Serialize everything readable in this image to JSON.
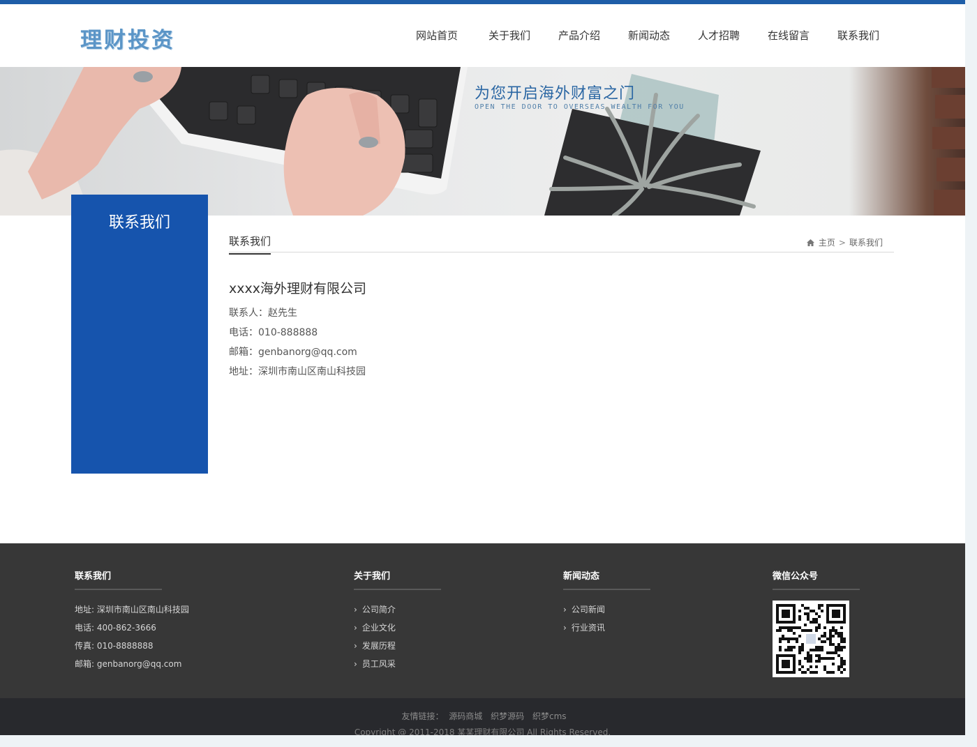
{
  "header": {
    "logo_text": "理财投资",
    "nav": [
      "网站首页",
      "关于我们",
      "产品介绍",
      "新闻动态",
      "人才招聘",
      "在线留言",
      "联系我们"
    ]
  },
  "banner": {
    "title": "为您开启海外财富之门",
    "subtitle": "OPEN THE DOOR TO OVERSEAS WEALTH FOR YOU"
  },
  "sidebar": {
    "title": "联系我们"
  },
  "content": {
    "title": "联系我们",
    "breadcrumb": {
      "home": "主页",
      "separator": ">",
      "current": "联系我们"
    },
    "company": "xxxx海外理财有限公司",
    "contact_person": "联系人：赵先生",
    "phone": "电话：010-888888",
    "email": "邮箱：genbanorg@qq.com",
    "address": "地址：深圳市南山区南山科技园"
  },
  "footer": {
    "contact": {
      "title": "联系我们",
      "items": [
        "地址: 深圳市南山区南山科技园",
        "电话: 400-862-3666",
        "传真: 010-8888888",
        "邮箱: genbanorg@qq.com"
      ]
    },
    "about": {
      "title": "关于我们",
      "items": [
        "公司简介",
        "企业文化",
        "发展历程",
        "员工风采"
      ]
    },
    "news": {
      "title": "新闻动态",
      "items": [
        "公司新闻",
        "行业资讯"
      ]
    },
    "wechat": {
      "title": "微信公众号"
    },
    "links_label": "友情链接：",
    "links": [
      "源码商城",
      "织梦源码",
      "织梦cms"
    ],
    "copyright": "Copyright @ 2011-2018 某某理财有限公司 All Rights Reserved."
  },
  "colors": {
    "primary": "#1654ad",
    "topbar": "#1e5ea8",
    "footer_bg": "#373737",
    "bottom_bg": "#28292d"
  }
}
